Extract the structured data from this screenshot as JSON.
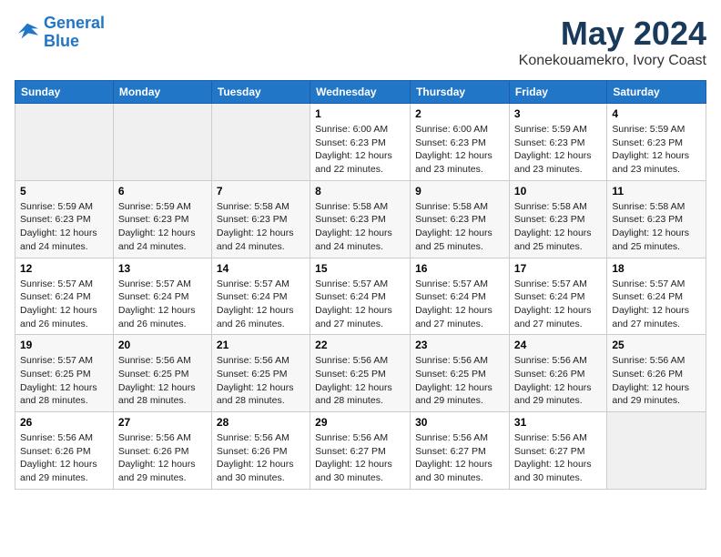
{
  "header": {
    "logo_line1": "General",
    "logo_line2": "Blue",
    "title": "May 2024",
    "subtitle": "Konekouamekro, Ivory Coast"
  },
  "weekdays": [
    "Sunday",
    "Monday",
    "Tuesday",
    "Wednesday",
    "Thursday",
    "Friday",
    "Saturday"
  ],
  "weeks": [
    [
      {
        "day": "",
        "info": ""
      },
      {
        "day": "",
        "info": ""
      },
      {
        "day": "",
        "info": ""
      },
      {
        "day": "1",
        "info": "Sunrise: 6:00 AM\nSunset: 6:23 PM\nDaylight: 12 hours\nand 22 minutes."
      },
      {
        "day": "2",
        "info": "Sunrise: 6:00 AM\nSunset: 6:23 PM\nDaylight: 12 hours\nand 23 minutes."
      },
      {
        "day": "3",
        "info": "Sunrise: 5:59 AM\nSunset: 6:23 PM\nDaylight: 12 hours\nand 23 minutes."
      },
      {
        "day": "4",
        "info": "Sunrise: 5:59 AM\nSunset: 6:23 PM\nDaylight: 12 hours\nand 23 minutes."
      }
    ],
    [
      {
        "day": "5",
        "info": "Sunrise: 5:59 AM\nSunset: 6:23 PM\nDaylight: 12 hours\nand 24 minutes."
      },
      {
        "day": "6",
        "info": "Sunrise: 5:59 AM\nSunset: 6:23 PM\nDaylight: 12 hours\nand 24 minutes."
      },
      {
        "day": "7",
        "info": "Sunrise: 5:58 AM\nSunset: 6:23 PM\nDaylight: 12 hours\nand 24 minutes."
      },
      {
        "day": "8",
        "info": "Sunrise: 5:58 AM\nSunset: 6:23 PM\nDaylight: 12 hours\nand 24 minutes."
      },
      {
        "day": "9",
        "info": "Sunrise: 5:58 AM\nSunset: 6:23 PM\nDaylight: 12 hours\nand 25 minutes."
      },
      {
        "day": "10",
        "info": "Sunrise: 5:58 AM\nSunset: 6:23 PM\nDaylight: 12 hours\nand 25 minutes."
      },
      {
        "day": "11",
        "info": "Sunrise: 5:58 AM\nSunset: 6:23 PM\nDaylight: 12 hours\nand 25 minutes."
      }
    ],
    [
      {
        "day": "12",
        "info": "Sunrise: 5:57 AM\nSunset: 6:24 PM\nDaylight: 12 hours\nand 26 minutes."
      },
      {
        "day": "13",
        "info": "Sunrise: 5:57 AM\nSunset: 6:24 PM\nDaylight: 12 hours\nand 26 minutes."
      },
      {
        "day": "14",
        "info": "Sunrise: 5:57 AM\nSunset: 6:24 PM\nDaylight: 12 hours\nand 26 minutes."
      },
      {
        "day": "15",
        "info": "Sunrise: 5:57 AM\nSunset: 6:24 PM\nDaylight: 12 hours\nand 27 minutes."
      },
      {
        "day": "16",
        "info": "Sunrise: 5:57 AM\nSunset: 6:24 PM\nDaylight: 12 hours\nand 27 minutes."
      },
      {
        "day": "17",
        "info": "Sunrise: 5:57 AM\nSunset: 6:24 PM\nDaylight: 12 hours\nand 27 minutes."
      },
      {
        "day": "18",
        "info": "Sunrise: 5:57 AM\nSunset: 6:24 PM\nDaylight: 12 hours\nand 27 minutes."
      }
    ],
    [
      {
        "day": "19",
        "info": "Sunrise: 5:57 AM\nSunset: 6:25 PM\nDaylight: 12 hours\nand 28 minutes."
      },
      {
        "day": "20",
        "info": "Sunrise: 5:56 AM\nSunset: 6:25 PM\nDaylight: 12 hours\nand 28 minutes."
      },
      {
        "day": "21",
        "info": "Sunrise: 5:56 AM\nSunset: 6:25 PM\nDaylight: 12 hours\nand 28 minutes."
      },
      {
        "day": "22",
        "info": "Sunrise: 5:56 AM\nSunset: 6:25 PM\nDaylight: 12 hours\nand 28 minutes."
      },
      {
        "day": "23",
        "info": "Sunrise: 5:56 AM\nSunset: 6:25 PM\nDaylight: 12 hours\nand 29 minutes."
      },
      {
        "day": "24",
        "info": "Sunrise: 5:56 AM\nSunset: 6:26 PM\nDaylight: 12 hours\nand 29 minutes."
      },
      {
        "day": "25",
        "info": "Sunrise: 5:56 AM\nSunset: 6:26 PM\nDaylight: 12 hours\nand 29 minutes."
      }
    ],
    [
      {
        "day": "26",
        "info": "Sunrise: 5:56 AM\nSunset: 6:26 PM\nDaylight: 12 hours\nand 29 minutes."
      },
      {
        "day": "27",
        "info": "Sunrise: 5:56 AM\nSunset: 6:26 PM\nDaylight: 12 hours\nand 29 minutes."
      },
      {
        "day": "28",
        "info": "Sunrise: 5:56 AM\nSunset: 6:26 PM\nDaylight: 12 hours\nand 30 minutes."
      },
      {
        "day": "29",
        "info": "Sunrise: 5:56 AM\nSunset: 6:27 PM\nDaylight: 12 hours\nand 30 minutes."
      },
      {
        "day": "30",
        "info": "Sunrise: 5:56 AM\nSunset: 6:27 PM\nDaylight: 12 hours\nand 30 minutes."
      },
      {
        "day": "31",
        "info": "Sunrise: 5:56 AM\nSunset: 6:27 PM\nDaylight: 12 hours\nand 30 minutes."
      },
      {
        "day": "",
        "info": ""
      }
    ]
  ]
}
